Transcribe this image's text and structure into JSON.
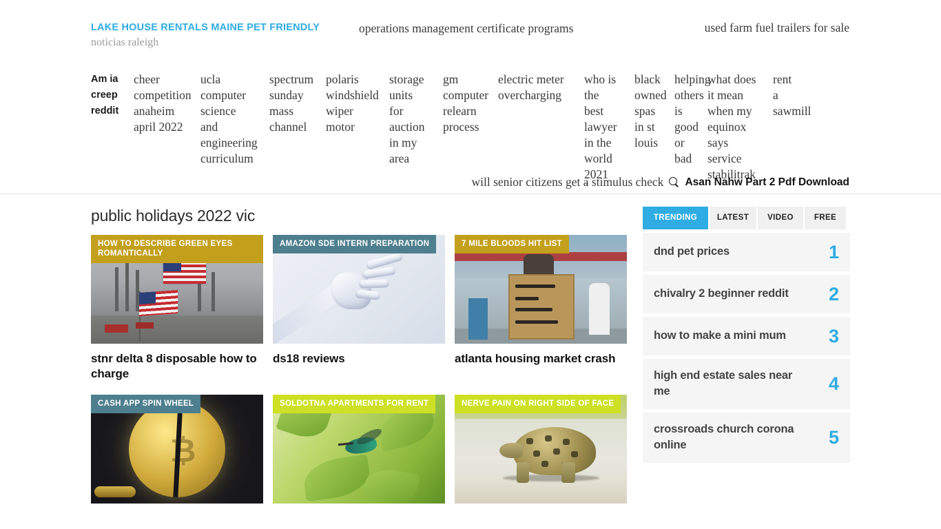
{
  "header": {
    "brand_title": "LAKE HOUSE RENTALS MAINE PET FRIENDLY",
    "brand_subtitle": "noticias raleigh",
    "middle_link": "operations management certificate programs",
    "right_link": "used farm fuel trailers for sale"
  },
  "nav": {
    "items": [
      {
        "label": "Am ia creep reddit",
        "active": true,
        "has_caret": false
      },
      {
        "label": "cheer competition anaheim april 2022",
        "active": false,
        "has_caret": false
      },
      {
        "label": "ucla computer science and engineering curriculum",
        "active": false,
        "has_caret": false
      },
      {
        "label": "spectrum sunday mass channel",
        "active": false,
        "has_caret": false
      },
      {
        "label": "polaris windshield wiper motor",
        "active": false,
        "has_caret": false
      },
      {
        "label": "storage units for auction in my area",
        "active": false,
        "has_caret": false
      },
      {
        "label": "gm computer relearn process",
        "active": false,
        "has_caret": false
      },
      {
        "label": "electric meter overcharging",
        "active": false,
        "has_caret": false
      },
      {
        "label": "who is the best lawyer in the world 2021",
        "active": false,
        "has_caret": true
      },
      {
        "label": "black owned spas in st louis",
        "active": false,
        "has_caret": false
      },
      {
        "label": "helping others is good or bad",
        "active": false,
        "has_caret": false
      },
      {
        "label": "what does it mean when my equinox says service stabilitrak",
        "active": false,
        "has_caret": false
      },
      {
        "label": "rent a sawmill",
        "active": false,
        "has_caret": false
      }
    ]
  },
  "search_bar": {
    "prefix_text": "will senior citizens get a stimulus check",
    "icon": "search-icon",
    "title": "Asan Nahw Part 2 Pdf Download"
  },
  "main": {
    "section_title": "public holidays 2022 vic",
    "cards": [
      {
        "badge": "HOW TO DESCRIBE GREEN EYES ROMANTICALLY",
        "badge_color": "#c3a01c",
        "title": "stnr delta 8 disposable how to charge",
        "image": "oil-refinery-with-american-flags"
      },
      {
        "badge": "AMAZON SDE INTERN PREPARATION",
        "badge_color": "#4d7f8e",
        "title": "ds18 reviews",
        "image": "robotic-hand"
      },
      {
        "badge": "7 MILE BLOODS HIT LIST",
        "badge_color": "#c3a01c",
        "title": "atlanta housing market crash",
        "image": "climate-protest-sign"
      },
      {
        "badge": "CASH APP SPIN WHEEL",
        "badge_color": "#4d7f8e",
        "title": "",
        "image": "cracked-bitcoin-coin"
      },
      {
        "badge": "SOLDOTNA APARTMENTS FOR RENT",
        "badge_color": "#cde024",
        "title": "",
        "image": "hummingbird-on-green-leaves"
      },
      {
        "badge": "NERVE PAIN ON RIGHT SIDE OF FACE",
        "badge_color": "#cde024",
        "title": "",
        "image": "leopard-tortoise-walking"
      }
    ]
  },
  "sidebar": {
    "tabs": [
      {
        "label": "TRENDING",
        "active": true
      },
      {
        "label": "LATEST",
        "active": false
      },
      {
        "label": "VIDEO",
        "active": false
      },
      {
        "label": "FREE",
        "active": false
      }
    ],
    "trending": [
      {
        "rank": "1",
        "label": "dnd pet prices"
      },
      {
        "rank": "2",
        "label": "chivalry 2 beginner reddit"
      },
      {
        "rank": "3",
        "label": "how to make a mini mum"
      },
      {
        "rank": "4",
        "label": "high end estate sales near me"
      },
      {
        "rank": "5",
        "label": "crossroads church corona online"
      }
    ]
  },
  "colors": {
    "accent": "#2eace3",
    "gold": "#c3a01c",
    "teal": "#4d7f8e",
    "lime": "#cde024"
  }
}
